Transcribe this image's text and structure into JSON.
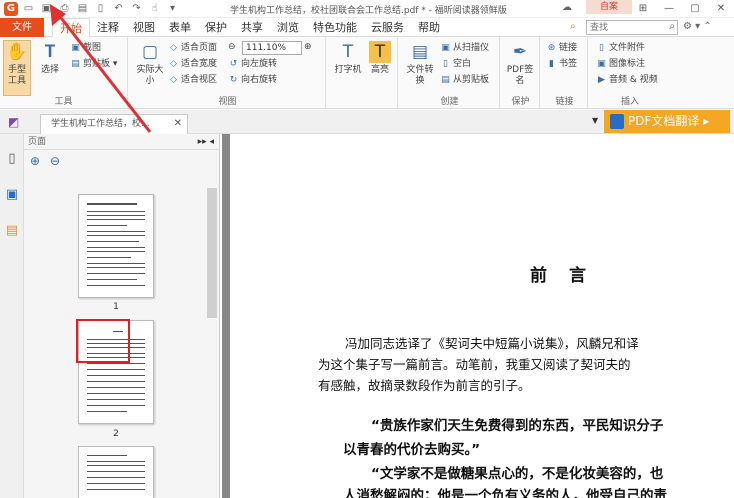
{
  "titlebar": {
    "title": "学生机构工作总结，校社团联合会工作总结.pdf * - 福昕阅读器领鲜版",
    "theme_label": "自案"
  },
  "menubar": {
    "file": "文件",
    "tabs": [
      "开始",
      "注释",
      "视图",
      "表单",
      "保护",
      "共享",
      "浏览",
      "特色功能",
      "云服务",
      "帮助"
    ],
    "search_placeholder": "查找"
  },
  "ribbon": {
    "tools": {
      "hand": "手型工具",
      "select": "选择",
      "screenshot": "截图",
      "clipboard": "剪贴板",
      "label": "工具"
    },
    "view": {
      "actual_size": "实际大小",
      "fit_page": "适合页面",
      "fit_width": "适合宽度",
      "fit_visible": "适合视区",
      "zoom": "111.10%",
      "rotate_left": "向左旋转",
      "rotate_right": "向右旋转",
      "label": "视图"
    },
    "comment": {
      "typewriter": "打字机",
      "highlight": "高亮"
    },
    "create": {
      "file_convert": "文件转换",
      "from_scanner": "从扫描仪",
      "blank": "空白",
      "from_clipboard": "从剪贴板",
      "label": "创建"
    },
    "protect": {
      "pdf_sign": "PDF签名",
      "label": "保护"
    },
    "links": {
      "link": "链接",
      "bookmark": "书签",
      "label": "链接"
    },
    "insert": {
      "file_attachment": "文件附件",
      "image_annotation": "图像标注",
      "audio_video": "音频 & 视频",
      "label": "插入"
    }
  },
  "tabstrip": {
    "doc_tab": "学生机构工作总结，校...",
    "translate": "PDF文档翻译"
  },
  "pagepanel": {
    "header": "页面",
    "pages": [
      "1",
      "2"
    ]
  },
  "document": {
    "heading": "前言",
    "para1_line1": "冯加同志选译了《契诃夫中短篇小说集》，风麟兄和译",
    "para1_line2": "为这个集子写一篇前言。动笔前，我重又阅读了契诃夫的",
    "para1_line3": "有感触，故摘录数段作为前言的引子。",
    "quote1_line1": "“贵族作家们天生免费得到的东西，平民知识分子",
    "quote1_line2": "以青春的代价去购买。”",
    "quote2_line1": "“文学家不是做糖果点心的，不是化妆美容的，也",
    "quote2_line2": "人消愁解闷的；他是一个负有义务的人，他受自己的责"
  }
}
